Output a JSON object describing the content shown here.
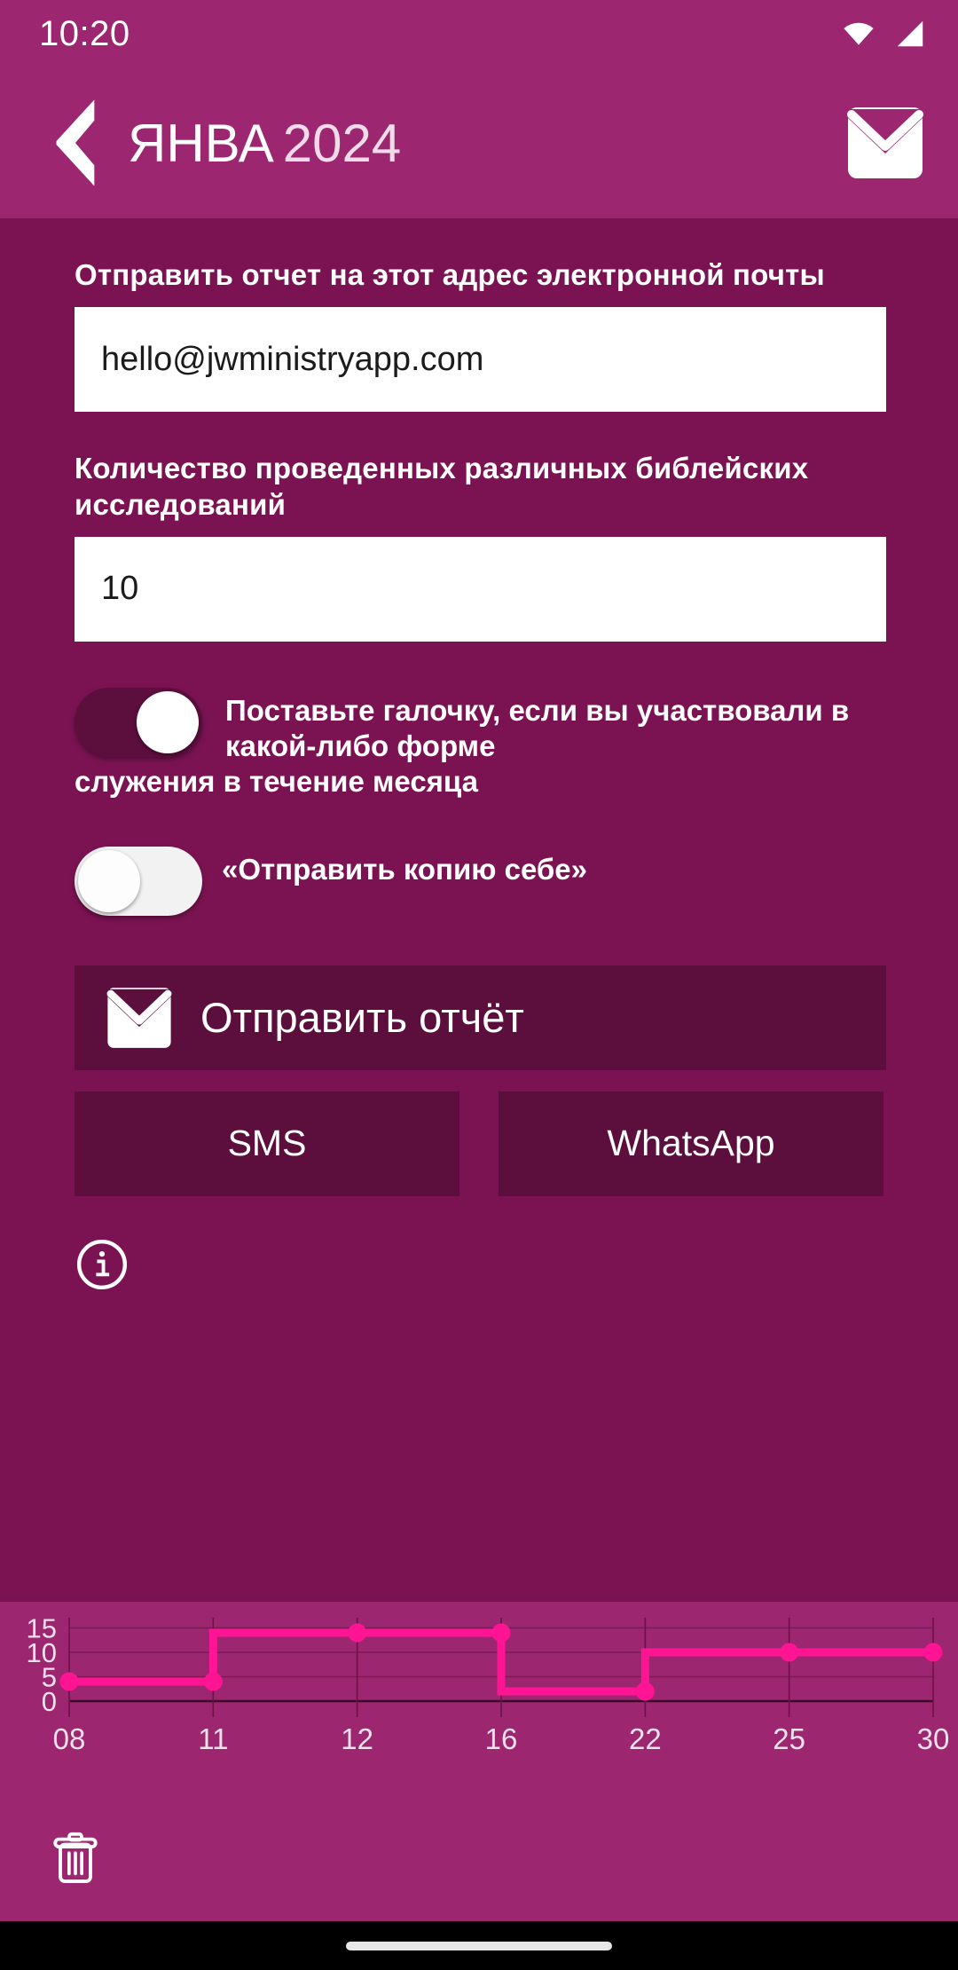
{
  "status_bar": {
    "time": "10:20",
    "icons": [
      "wifi-icon",
      "cellular-signal-icon"
    ]
  },
  "app_bar": {
    "back_icon": "back-chevron-icon",
    "month": "ЯНВА",
    "year": "2024",
    "mail_icon": "envelope-icon"
  },
  "form": {
    "email_label": "Отправить отчет на этот адрес электронной почты",
    "email_value": "hello@jwministryapp.com",
    "email_placeholder": "hello@jwministryapp.com",
    "studies_label": "Количество проведенных различных библейских исследований",
    "studies_value": "10",
    "studies_placeholder": "0",
    "participated_toggle": {
      "label_line1": "Поставьте галочку, если вы",
      "label_line2": "участвовали в какой-либо форме",
      "label_line3": "служения в течение месяца",
      "state": "on"
    },
    "copy_toggle": {
      "label": "«Отправить копию себе»",
      "state": "off"
    }
  },
  "actions": {
    "send_report_label": "Отправить отчёт",
    "send_report_icon": "envelope-icon",
    "sms_label": "SMS",
    "whatsapp_label": "WhatsApp",
    "info_icon": "info-circle-icon"
  },
  "bottom_bar": {
    "delete_icon": "trash-icon"
  },
  "nav_bar": {
    "handle": "home-gesture-handle"
  },
  "colors": {
    "header": "#9c266f",
    "body": "#7b1352",
    "button": "#5c0e3d",
    "accent_line": "#ff1493",
    "input_bg": "#ffffff",
    "text": "#ffffff"
  },
  "chart_data": {
    "type": "line",
    "title": "",
    "xlabel": "",
    "ylabel": "",
    "x": [
      "08",
      "11",
      "12",
      "16",
      "22",
      "25",
      "30"
    ],
    "values": [
      4,
      4,
      14,
      14,
      2,
      10,
      10
    ],
    "yticks": [
      0,
      5,
      10,
      15
    ],
    "ylim": [
      0,
      16
    ],
    "grid": true,
    "legend": "none",
    "step": "post",
    "line_color": "#ff1493",
    "marker": "circle"
  }
}
